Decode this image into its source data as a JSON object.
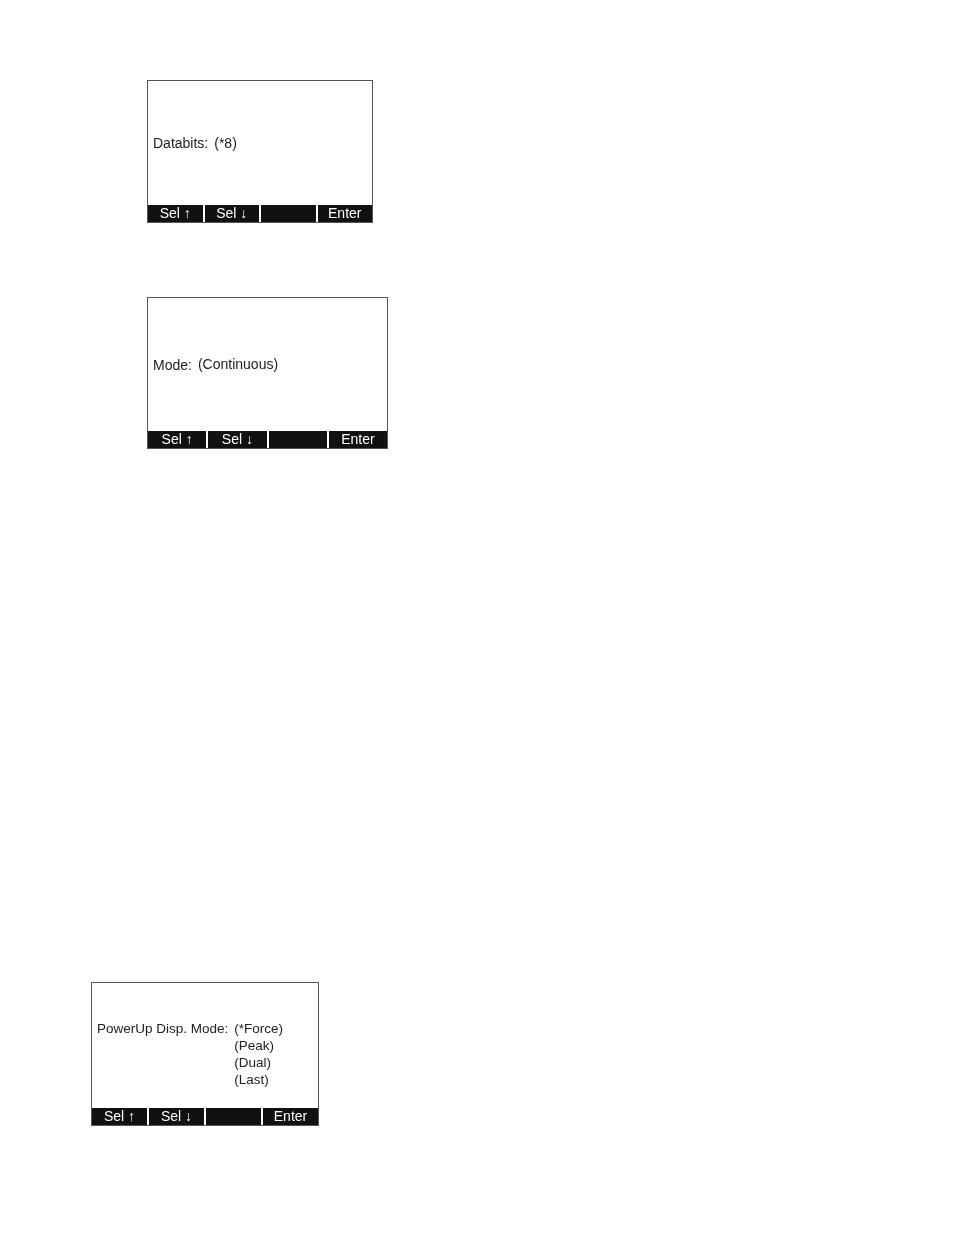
{
  "screens": [
    {
      "label": "Databits:",
      "options": [
        "(*8)"
      ],
      "softkeys": [
        {
          "kind": "label",
          "label": "Sel ↑"
        },
        {
          "kind": "label",
          "label": "Sel ↓"
        },
        {
          "kind": "blank"
        },
        {
          "kind": "label",
          "label": "Enter"
        }
      ]
    },
    {
      "label": "Mode:",
      "options": [
        "(Continuous)"
      ],
      "softkeys": [
        {
          "kind": "label",
          "label": "Sel ↑"
        },
        {
          "kind": "label",
          "label": "Sel ↓"
        },
        {
          "kind": "blank"
        },
        {
          "kind": "label",
          "label": "Enter"
        }
      ]
    },
    {
      "label": "PowerUp Disp. Mode:",
      "options": [
        "(*Force)",
        "(Peak)",
        "(Dual)",
        "(Last)"
      ],
      "softkeys": [
        {
          "kind": "label",
          "label": "Sel ↑"
        },
        {
          "kind": "label",
          "label": "Sel ↓"
        },
        {
          "kind": "blank"
        },
        {
          "kind": "label",
          "label": "Enter"
        }
      ]
    }
  ]
}
